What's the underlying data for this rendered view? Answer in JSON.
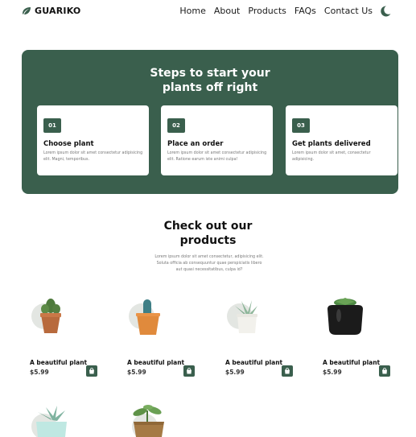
{
  "header": {
    "logo_text": "GUARIKO",
    "nav": [
      "Home",
      "About",
      "Products",
      "FAQs",
      "Contact Us"
    ]
  },
  "steps": {
    "title_line1": "Steps to start your",
    "title_line2": "plants off right",
    "items": [
      {
        "num": "01",
        "title": "Choose plant",
        "desc": "Lorem ipsum dolor sit amet consectetur adipisicing elit. Magni, temporibus."
      },
      {
        "num": "02",
        "title": "Place an order",
        "desc": "Lorem ipsum dolor sit amet consectetur adipisicing elit. Ratione earum iste animi culpa!"
      },
      {
        "num": "03",
        "title": "Get plants delivered",
        "desc": "Lorem ipsum dolor sit amet, consectetur adipisicing."
      }
    ]
  },
  "products": {
    "title_line1": "Check out our",
    "title_line2": "products",
    "description": "Lorem ipsum dolor sit amet consectetur, adipisicing elit. Soluta officia ab consequuntur quae perspiciatis libero aut quasi necessitatibus, culpa id?",
    "items": [
      {
        "name": "A beautiful plant",
        "price": "$5.99"
      },
      {
        "name": "A beautiful plant",
        "price": "$5.99"
      },
      {
        "name": "A beautiful plant",
        "price": "$5.99"
      },
      {
        "name": "A beautiful plant",
        "price": "$5.99"
      }
    ]
  },
  "colors": {
    "brand": "#3a5f4d"
  }
}
